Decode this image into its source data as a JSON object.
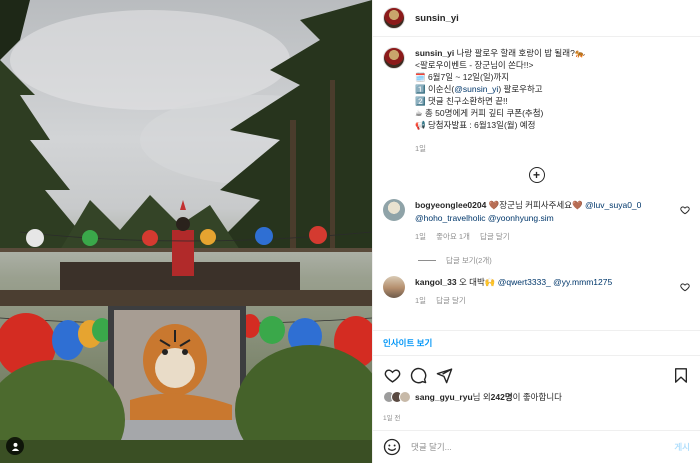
{
  "header": {
    "username": "sunsin_yi"
  },
  "caption": {
    "username": "sunsin_yi",
    "line1": "나랑 팔로우 할래 호랑이 밥 될래?🐅",
    "line2": "<팔로우이벤트 - 장군님이 쏜다!!>",
    "line3": "🗓️ 6월7일 ~ 12일(일)까지",
    "line4_prefix": "1️⃣ 이순신(",
    "line4_mention": "@sunsin_yi",
    "line4_suffix": ") 팔로우하고",
    "line5": "2️⃣ 댓글 친구소환하면 끝!!",
    "line6": "☕ 총 50명에게 커피 깊티 쿠폰(추첨)",
    "line7": "📢 당첨자발표 : 6월13일(월) 예정",
    "time": "1일"
  },
  "load_more_icon": "plus-circle-icon",
  "comments": [
    {
      "username": "bogyeonglee0204",
      "text": "🤎장군님 커피사주세요🤎",
      "mention1": "@luv_suya0_0",
      "mention2": "@hoho_travelholic",
      "mention3": "@yoonhyung.sim",
      "time": "1일",
      "likes": "좋아요 1개",
      "reply": "답글 달기",
      "view_replies": "답글 보기(2개)"
    },
    {
      "username": "kangol_33",
      "text": "오 대박🙌",
      "mention1": "@qwert3333_",
      "mention2": "@yy.mmm1275",
      "time": "1일",
      "reply": "답글 달기"
    }
  ],
  "insights_label": "인사이트 보기",
  "actions": {
    "like_icon": "heart-icon",
    "comment_icon": "comment-icon",
    "share_icon": "send-icon",
    "save_icon": "bookmark-icon"
  },
  "likes": {
    "user": "sang_gyu_ryu",
    "suffix": "님 외 ",
    "count": "242명",
    "suffix2": "이 좋아합니다"
  },
  "post_time": "1일 전",
  "add_comment": {
    "placeholder": "댓글 달기...",
    "post_label": "게시"
  },
  "colors": {
    "accent": "#0095f6",
    "mention": "#00376b",
    "muted": "#8e8e8e",
    "post_disabled": "#b2dffc"
  }
}
